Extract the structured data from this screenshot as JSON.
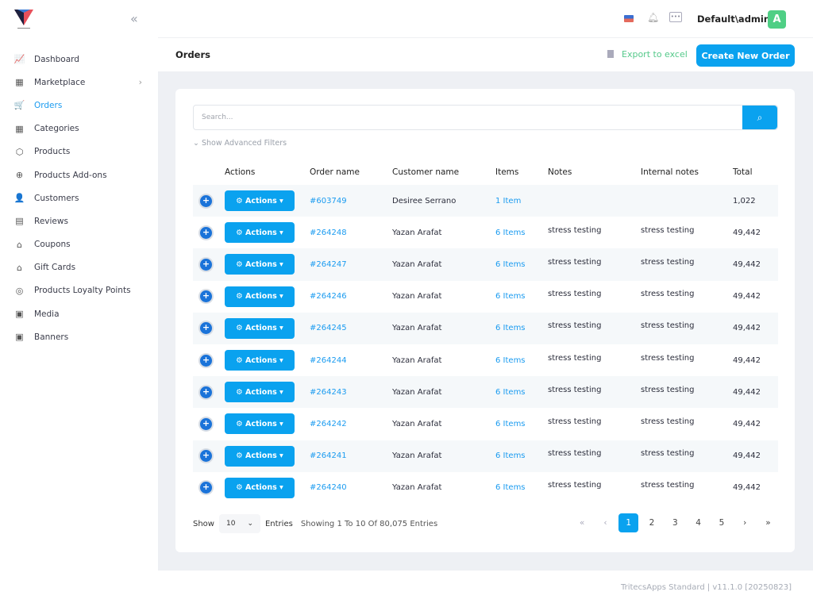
{
  "brand": {
    "logo_text": "Tritecs"
  },
  "sidebar": {
    "items": [
      {
        "label": "Dashboard",
        "icon": "chart-icon",
        "glyph": "📈"
      },
      {
        "label": "Marketplace",
        "icon": "store-icon",
        "glyph": "▦",
        "chevron": "›"
      },
      {
        "label": "Orders",
        "icon": "cart-icon",
        "glyph": "🛒",
        "active": true
      },
      {
        "label": "Categories",
        "icon": "grid-icon",
        "glyph": "▦"
      },
      {
        "label": "Products",
        "icon": "box-icon",
        "glyph": "⬡"
      },
      {
        "label": "Products Add-ons",
        "icon": "plus-circle-icon",
        "glyph": "⊕"
      },
      {
        "label": "Customers",
        "icon": "user-icon",
        "glyph": "👤"
      },
      {
        "label": "Reviews",
        "icon": "comment-icon",
        "glyph": "▤"
      },
      {
        "label": "Coupons",
        "icon": "gift-icon",
        "glyph": "⌂"
      },
      {
        "label": "Gift Cards",
        "icon": "gift-card-icon",
        "glyph": "⌂"
      },
      {
        "label": "Products Loyalty Points",
        "icon": "coins-icon",
        "glyph": "◎"
      },
      {
        "label": "Media",
        "icon": "image-icon",
        "glyph": "▣"
      },
      {
        "label": "Banners",
        "icon": "banner-icon",
        "glyph": "▣"
      }
    ]
  },
  "header": {
    "user": "Default\\admin",
    "avatar": "A"
  },
  "page": {
    "title": "Orders",
    "export_label": "Export to excel",
    "create_label": "Create New Order"
  },
  "search": {
    "placeholder": "Search...",
    "advanced": "Show Advanced Filters"
  },
  "table": {
    "columns": [
      "",
      "Actions",
      "Order name",
      "Customer name",
      "Items",
      "Notes",
      "Internal notes",
      "Total"
    ],
    "action_label": "Actions ▾",
    "rows": [
      {
        "order": "#603749",
        "customer": "Desiree Serrano",
        "items": "1 Item",
        "notes": "",
        "internal": "",
        "total": "1,022"
      },
      {
        "order": "#264248",
        "customer": "Yazan Arafat",
        "items": "6 Items",
        "notes": "stress testing",
        "internal": "stress testing",
        "total": "49,442"
      },
      {
        "order": "#264247",
        "customer": "Yazan Arafat",
        "items": "6 Items",
        "notes": "stress testing",
        "internal": "stress testing",
        "total": "49,442"
      },
      {
        "order": "#264246",
        "customer": "Yazan Arafat",
        "items": "6 Items",
        "notes": "stress testing",
        "internal": "stress testing",
        "total": "49,442"
      },
      {
        "order": "#264245",
        "customer": "Yazan Arafat",
        "items": "6 Items",
        "notes": "stress testing",
        "internal": "stress testing",
        "total": "49,442"
      },
      {
        "order": "#264244",
        "customer": "Yazan Arafat",
        "items": "6 Items",
        "notes": "stress testing",
        "internal": "stress testing",
        "total": "49,442"
      },
      {
        "order": "#264243",
        "customer": "Yazan Arafat",
        "items": "6 Items",
        "notes": "stress testing",
        "internal": "stress testing",
        "total": "49,442"
      },
      {
        "order": "#264242",
        "customer": "Yazan Arafat",
        "items": "6 Items",
        "notes": "stress testing",
        "internal": "stress testing",
        "total": "49,442"
      },
      {
        "order": "#264241",
        "customer": "Yazan Arafat",
        "items": "6 Items",
        "notes": "stress testing",
        "internal": "stress testing",
        "total": "49,442"
      },
      {
        "order": "#264240",
        "customer": "Yazan Arafat",
        "items": "6 Items",
        "notes": "stress testing",
        "internal": "stress testing",
        "total": "49,442"
      }
    ]
  },
  "pagination": {
    "show": "Show",
    "page_size": "10",
    "entries": "Entries",
    "info": "Showing 1 To 10 Of 80,075 Entries",
    "first": "«",
    "prev": "‹",
    "pages": [
      "1",
      "2",
      "3",
      "4",
      "5"
    ],
    "current": "1",
    "next": "›",
    "last": "»"
  },
  "footer": {
    "version": "TritecsApps Standard | v11.1.0 [20250823]"
  },
  "colors": {
    "accent": "#0aa2ef",
    "export": "#55c98a",
    "avatar": "#4fcf85"
  }
}
